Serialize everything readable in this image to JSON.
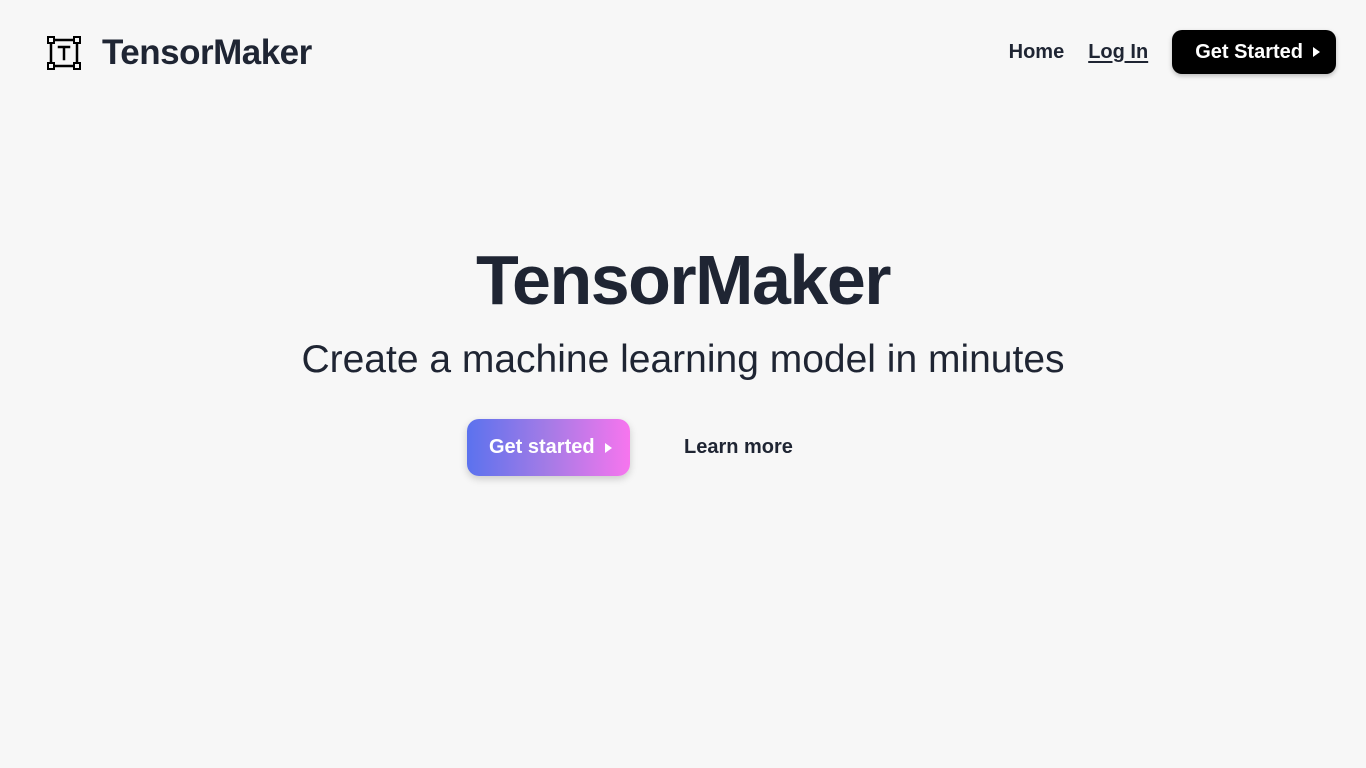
{
  "header": {
    "brand_name": "TensorMaker",
    "brand_icon": "transform-text-icon",
    "nav": {
      "home_label": "Home",
      "login_label": "Log In",
      "cta_label": "Get Started",
      "cta_icon": "play-icon"
    }
  },
  "hero": {
    "title": "TensorMaker",
    "subtitle": "Create a machine learning model in minutes",
    "primary_button_label": "Get started",
    "primary_button_icon": "play-icon",
    "secondary_link_label": "Learn more"
  },
  "colors": {
    "background": "#f7f7f7",
    "text": "#1f2533",
    "cta_background": "#000000",
    "gradient_start": "#5b72ee",
    "gradient_end": "#f775ee"
  }
}
